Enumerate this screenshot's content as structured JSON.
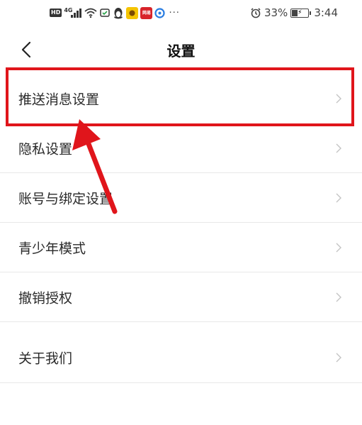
{
  "status_bar": {
    "left_icons": [
      "hd-icon",
      "signal-4g-icon",
      "wifi-icon",
      "notification-icon",
      "qq-penguin-icon",
      "yellow-app-icon",
      "netease-app-icon",
      "browser-icon",
      "more-dots-icon"
    ],
    "hd_label": "HD",
    "network_label": "4G",
    "netease_label": "网易",
    "more_label": "···",
    "battery_percent_text": "33%",
    "battery_level": 0.33,
    "time": "3:44"
  },
  "header": {
    "title": "设置",
    "back_icon": "chevron-left-icon"
  },
  "settings": {
    "items": [
      {
        "label": "推送消息设置",
        "icon": "chevron-right-icon"
      },
      {
        "label": "隐私设置",
        "icon": "chevron-right-icon"
      },
      {
        "label": "账号与绑定设置",
        "icon": "chevron-right-icon"
      },
      {
        "label": "青少年模式",
        "icon": "chevron-right-icon"
      },
      {
        "label": "撤销授权",
        "icon": "chevron-right-icon"
      },
      {
        "label": "关于我们",
        "icon": "chevron-right-icon"
      }
    ]
  },
  "annotation": {
    "highlight_color": "#e0151b",
    "arrow_color": "#e0151b"
  }
}
